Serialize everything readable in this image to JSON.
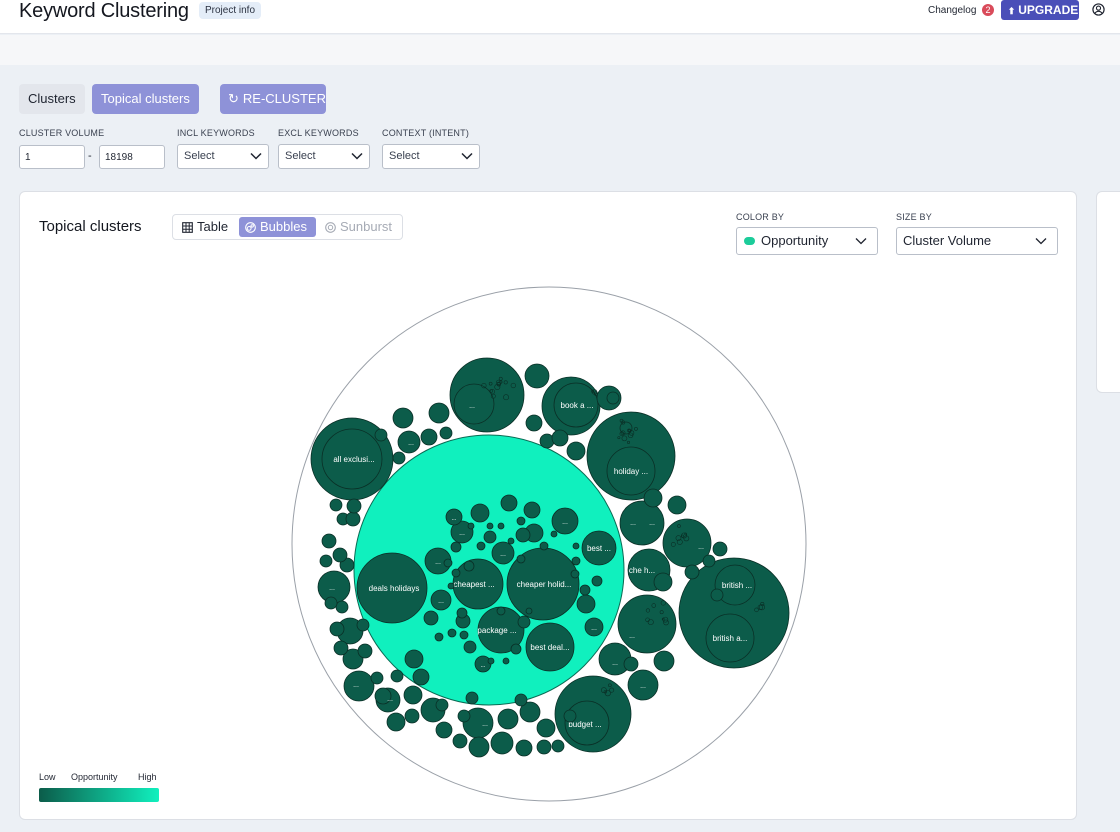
{
  "header": {
    "title": "Keyword Clustering",
    "project_info": "Project info",
    "changelog": "Changelog",
    "changelog_count": "2",
    "upgrade": "UPGRADE"
  },
  "tabs": {
    "clusters": "Clusters",
    "topical": "Topical clusters",
    "recluster": "RE-CLUSTER"
  },
  "filters": {
    "cluster_volume_label": "CLUSTER VOLUME",
    "volume_min": "1",
    "volume_max": "18198",
    "incl_label": "INCL KEYWORDS",
    "excl_label": "EXCL KEYWORDS",
    "context_label": "CONTEXT (INTENT)",
    "incl_value": "Select",
    "excl_value": "Select",
    "context_value": "Select"
  },
  "card": {
    "title": "Topical clusters",
    "view_table": "Table",
    "view_bubbles": "Bubbles",
    "view_sunburst": "Sunburst",
    "color_by_label": "COLOR BY",
    "color_by_value": "Opportunity",
    "size_by_label": "SIZE BY",
    "size_by_value": "Cluster Volume"
  },
  "legend": {
    "low": "Low",
    "title": "Opportunity",
    "high": "High"
  },
  "colors": {
    "accent": "#8e92d8",
    "upgrade": "#4a4fb8",
    "bubble_low": "#0c5c4a",
    "bubble_high": "#10f0be"
  },
  "bubble_labels": {
    "central": "deals holidays",
    "cheapest": "cheapest ...",
    "cheaper": "cheaper holid...",
    "package": "package ...",
    "best_deal": "best deal...",
    "best": "best ...",
    "all_excl": "all exclusi...",
    "book": "book a ...",
    "holiday": "holiday ...",
    "che_h": "che h...",
    "british1": "british ...",
    "british2": "british a...",
    "budget": "budget ...",
    "ellipsis": "..."
  }
}
